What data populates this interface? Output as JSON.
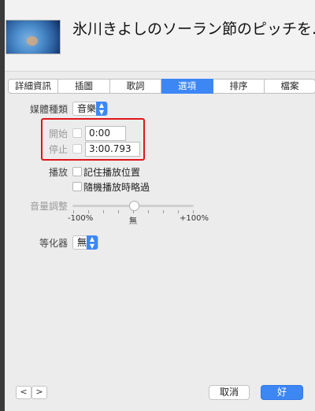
{
  "header": {
    "title": "氷川きよしのソーラン節のピッチを..."
  },
  "tabs": [
    {
      "label": "詳細資訊",
      "active": false
    },
    {
      "label": "插圖",
      "active": false
    },
    {
      "label": "歌詞",
      "active": false
    },
    {
      "label": "選項",
      "active": true
    },
    {
      "label": "排序",
      "active": false
    },
    {
      "label": "檔案",
      "active": false
    }
  ],
  "options": {
    "media_kind": {
      "label": "媒體種類",
      "value": "音樂"
    },
    "start": {
      "label": "開始",
      "checked": false,
      "value": "0:00"
    },
    "stop": {
      "label": "停止",
      "checked": false,
      "value": "3:00.793"
    },
    "playback": {
      "label": "播放",
      "remember_position": {
        "label": "記住播放位置",
        "checked": false
      },
      "skip_when_shuffling": {
        "label": "隨機播放時略過",
        "checked": false
      }
    },
    "volume": {
      "label": "音量調整",
      "min_label": "-100%",
      "mid_label": "無",
      "max_label": "+100%",
      "value_percent": 0
    },
    "equalizer": {
      "label": "等化器",
      "value": "無"
    }
  },
  "footer": {
    "prev_icon": "chevron-left-icon",
    "next_icon": "chevron-right-icon",
    "cancel_label": "取消",
    "ok_label": "好"
  },
  "colors": {
    "accent": "#3d87f5",
    "highlight_box": "#e0161c"
  }
}
